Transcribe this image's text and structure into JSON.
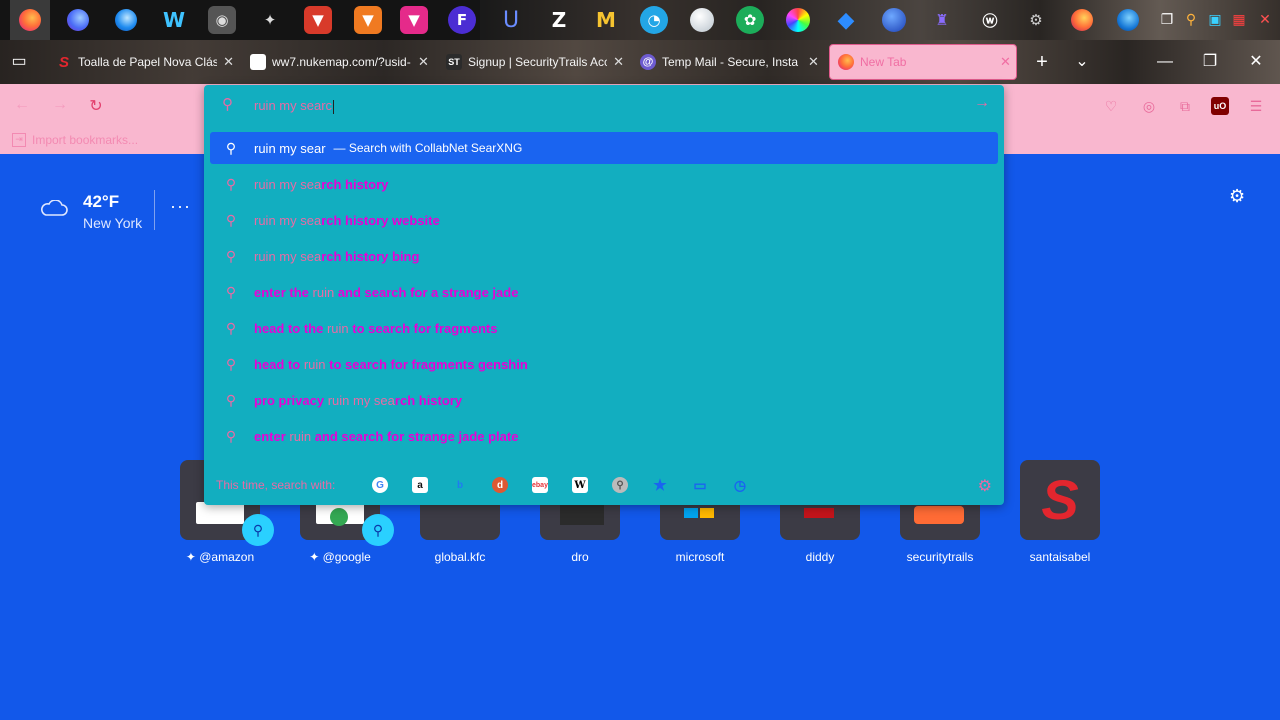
{
  "taskbar": {
    "icons": [
      "firefox-icon",
      "firefox-dev-icon",
      "firefox-blue-icon",
      "w-app-icon",
      "raccoon-icon",
      "bird-icon",
      "fox-red-icon",
      "fox-orange-icon",
      "fox-pink-icon",
      "f-app-icon",
      "u-app-icon",
      "z-app-icon",
      "m-app-icon",
      "blue-circle-icon",
      "white-circle-icon",
      "green-icon",
      "rainbow-icon",
      "globe-icon",
      "blue-ball-icon",
      "purple-app-icon",
      "wordpress-icon",
      "settings-app-icon",
      "firefox-orange-icon",
      "edge-icon"
    ]
  },
  "tabs": [
    {
      "title": "Toalla de Papel Nova Clás",
      "fav_color": "#e3262e",
      "fav_glyph": "S"
    },
    {
      "title": "ww7.nukemap.com/?usid-",
      "fav_color": "#ffffff",
      "fav_glyph": ""
    },
    {
      "title": "Signup | SecurityTrails Acc",
      "fav_color": "#2b2b2b",
      "fav_glyph": "ST"
    },
    {
      "title": "Temp Mail - Secure, Insta",
      "fav_color": "#6d5bd0",
      "fav_glyph": "@"
    },
    {
      "title": "New Tab",
      "fav_color": "#ff7139",
      "fav_glyph": ""
    }
  ],
  "bookmarks": {
    "import_label": "Import bookmarks..."
  },
  "urlbar": {
    "value": "ruin my searc"
  },
  "suggestions": {
    "selected": {
      "text": "ruin my sear",
      "engine": "— Search with CollabNet SearXNG"
    },
    "items": [
      {
        "pre": "",
        "n": "ruin my sea",
        "b": "rch history"
      },
      {
        "pre": "",
        "n": "ruin my sea",
        "b": "rch history website"
      },
      {
        "pre": "",
        "n": "ruin my sea",
        "b": "rch history bing"
      },
      {
        "pre": "enter the ",
        "n": "ruin",
        "b": " and sea",
        "n2": "",
        "b2": "rch for a strange jade"
      },
      {
        "pre": "head to the ",
        "n": "ruin",
        "b": " to sea",
        "n2": "",
        "b2": "rch for fragments"
      },
      {
        "pre": "head to ",
        "n": "ruin",
        "b": " to sea",
        "n2": "",
        "b2": "rch for fragments genshin"
      },
      {
        "pre": "pro privacy ",
        "n": "ruin my sea",
        "b": "rch history",
        "n2": "",
        "b2": ""
      },
      {
        "pre": "enter ",
        "n": "ruin",
        "b": " and sea",
        "n2": "",
        "b2": "rch for strange jade plate"
      }
    ]
  },
  "oneoff": {
    "label": "This time, search with:",
    "engines": [
      "google-icon",
      "amazon-icon",
      "bing-icon",
      "duckduckgo-icon",
      "ebay-icon",
      "wikipedia-icon",
      "search-engine-icon",
      "bookmarks-star-icon",
      "tabs-icon",
      "history-icon"
    ]
  },
  "weather": {
    "temp": "42°F",
    "city": "New York"
  },
  "shortcuts": [
    {
      "label": "@amazon",
      "pinned": true
    },
    {
      "label": "@google",
      "pinned": true
    },
    {
      "label": "global.kfc",
      "pinned": false
    },
    {
      "label": "dro",
      "pinned": false
    },
    {
      "label": "microsoft",
      "pinned": false
    },
    {
      "label": "diddy",
      "pinned": false
    },
    {
      "label": "securitytrails",
      "pinned": false
    },
    {
      "label": "santaisabel",
      "pinned": false
    }
  ],
  "colors": {
    "page_bg": "#1258ea",
    "toolbar": "#f9b7cf",
    "dropdown": "#12aec0",
    "selected": "#1a64f0",
    "accent": "#e86ba5"
  }
}
